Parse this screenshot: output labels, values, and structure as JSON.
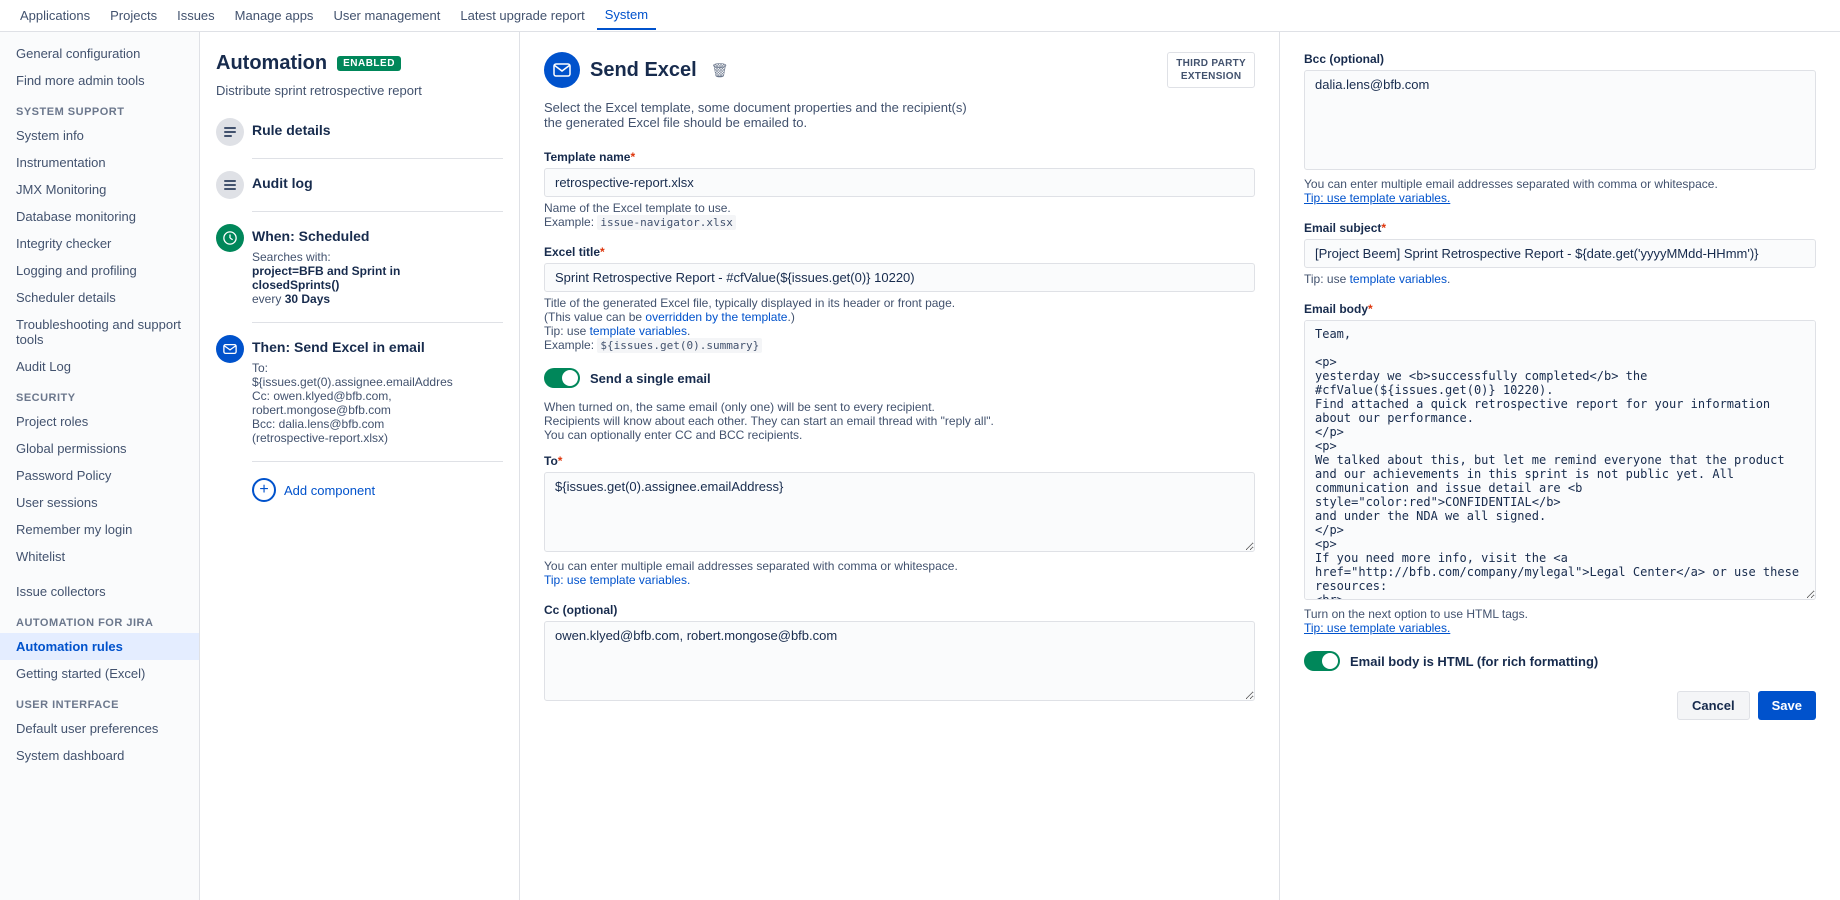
{
  "topNav": {
    "items": [
      {
        "label": "Applications",
        "active": false
      },
      {
        "label": "Projects",
        "active": false
      },
      {
        "label": "Issues",
        "active": false
      },
      {
        "label": "Manage apps",
        "active": false
      },
      {
        "label": "User management",
        "active": false
      },
      {
        "label": "Latest upgrade report",
        "active": false
      },
      {
        "label": "System",
        "active": true
      }
    ]
  },
  "sidebar": {
    "topItems": [
      {
        "label": "General configuration",
        "active": false
      },
      {
        "label": "Find more admin tools",
        "active": false
      }
    ],
    "sections": [
      {
        "label": "SYSTEM SUPPORT",
        "items": [
          {
            "label": "System info",
            "active": false
          },
          {
            "label": "Instrumentation",
            "active": false
          },
          {
            "label": "JMX Monitoring",
            "active": false
          },
          {
            "label": "Database monitoring",
            "active": false
          },
          {
            "label": "Integrity checker",
            "active": false
          },
          {
            "label": "Logging and profiling",
            "active": false
          },
          {
            "label": "Scheduler details",
            "active": false
          },
          {
            "label": "Troubleshooting and support tools",
            "active": false
          },
          {
            "label": "Audit Log",
            "active": false
          }
        ]
      },
      {
        "label": "SECURITY",
        "items": [
          {
            "label": "Project roles",
            "active": false
          },
          {
            "label": "Global permissions",
            "active": false
          },
          {
            "label": "Password Policy",
            "active": false
          },
          {
            "label": "User sessions",
            "active": false
          },
          {
            "label": "Remember my login",
            "active": false
          },
          {
            "label": "Whitelist",
            "active": false
          }
        ]
      },
      {
        "label": "",
        "items": [
          {
            "label": "Issue collectors",
            "active": false
          }
        ]
      },
      {
        "label": "AUTOMATION FOR JIRA",
        "items": [
          {
            "label": "Automation rules",
            "active": true
          },
          {
            "label": "Getting started (Excel)",
            "active": false
          }
        ]
      },
      {
        "label": "USER INTERFACE",
        "items": [
          {
            "label": "Default user preferences",
            "active": false
          },
          {
            "label": "System dashboard",
            "active": false
          }
        ]
      }
    ]
  },
  "automation": {
    "title": "Automation",
    "badge": "ENABLED",
    "subtitle": "Distribute sprint retrospective report",
    "timeline": [
      {
        "type": "gray",
        "icon": "≡",
        "label": "Rule details"
      },
      {
        "type": "gray",
        "icon": "☰",
        "label": "Audit log"
      },
      {
        "type": "green",
        "icon": "⏰",
        "label": "When: Scheduled",
        "detail": "Searches with:",
        "detail2": "project=BFB and Sprint in",
        "detail3": "closedSprints()",
        "detail4": "every",
        "detail4bold": "30 Days"
      },
      {
        "type": "blue",
        "icon": "✉",
        "label": "Then: Send Excel in email",
        "to": "To:",
        "toVal": "${issues.get(0).assignee.emailAddres",
        "cc": "Cc: owen.klyed@bfb.com,",
        "cc2": "robert.mongose@bfb.com",
        "bcc": "Bcc: dalia.lens@bfb.com",
        "file": "(retrospective-report.xlsx)"
      }
    ],
    "addComponent": "Add component"
  },
  "form": {
    "iconColor": "#0052cc",
    "title": "Send Excel",
    "thirdPartyBadge": "THIRD PARTY\nEXTENSION",
    "description": "Select the Excel template, some document properties and the recipient(s)\nthe generated Excel file should be emailed to.",
    "templateName": {
      "label": "Template name",
      "required": true,
      "value": "retrospective-report.xlsx",
      "hintExample": "issue-navigator.xlsx"
    },
    "excelTitle": {
      "label": "Excel title",
      "required": true,
      "value": "Sprint Retrospective Report - #cfValue(${issues.get(0)} 10220)",
      "hint1": "Title of the generated Excel file, typically displayed in its header or front page.",
      "hint2": "(This value can be overridden by the template.)",
      "hint3": "Tip: use template variables.",
      "hintExample": "${issues.get(0).summary}"
    },
    "sendSingleEmail": {
      "label": "Send a single email",
      "enabled": true,
      "desc1": "When turned on, the same email (only one) will be sent to every recipient.",
      "desc2": "Recipients will know about each other. They can start an email thread with \"reply all\".",
      "desc3": "You can optionally enter CC and BCC recipients."
    },
    "to": {
      "label": "To",
      "required": true,
      "value": "${issues.get(0).assignee.emailAddress}",
      "hint": "You can enter multiple email addresses separated with comma or whitespace.",
      "hintLink": "Tip: use template variables."
    },
    "cc": {
      "label": "Cc (optional)",
      "value": "owen.klyed@bfb.com, robert.mongose@bfb.com"
    }
  },
  "rightPanel": {
    "bcc": {
      "label": "Bcc (optional)",
      "value": "dalia.lens@bfb.com",
      "hint": "You can enter multiple email addresses separated with comma or whitespace.",
      "hintLink": "Tip: use template variables."
    },
    "emailSubject": {
      "label": "Email subject",
      "required": true,
      "value": "[Project Beem] Sprint Retrospective Report - ${date.get('yyyyMMdd-HHmm')}",
      "hint": "Tip: use template variables."
    },
    "emailBody": {
      "label": "Email body",
      "required": true,
      "value": "Team,\n\n<p>\nyesterday we <b>successfully completed</b> the #cfValue(${issues.get(0)} 10220).\nFind attached a quick retrospective report for your information about our performance.\n</p>\n<p>\nWe talked about this, but let me remind everyone that the product and our achievements in this sprint is not public yet. All communication and issue detail are <b style=\"color:red\">CONFIDENTIAL</b>\nand under the NDA we all signed.\n</p>\n<p>\nIf you need more info, visit the <a href=\"http://bfb.com/company/mylegal\">Legal Center</a> or use these resources:\n<br>\n  <ul>\n    <li>General NDA terms</li>\n    <li>Legal Obligations and Business Guidance</li>",
      "hint": "Turn on the next option to use HTML tags.",
      "hintLink": "Tip: use template variables."
    },
    "emailBodyHtml": {
      "label": "Email body is HTML (for rich formatting)",
      "enabled": true
    },
    "buttons": {
      "cancel": "Cancel",
      "save": "Save"
    }
  }
}
